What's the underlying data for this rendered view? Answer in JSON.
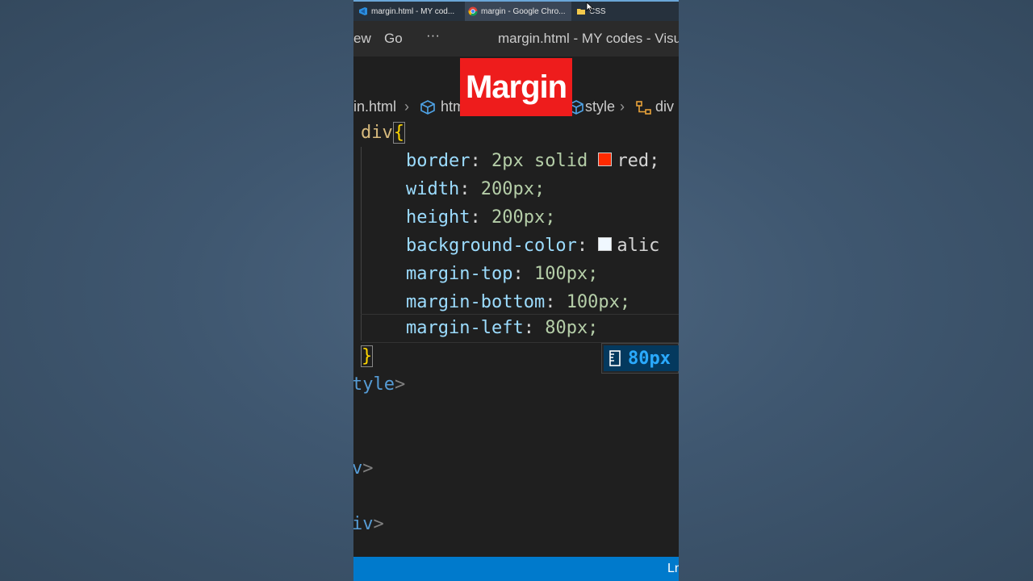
{
  "taskbar": {
    "tabs": [
      {
        "label": "margin.html - MY cod...",
        "icon": "vscode-icon",
        "active": false
      },
      {
        "label": "margin - Google Chro...",
        "icon": "chrome-icon",
        "active": true
      },
      {
        "label": "CSS",
        "icon": "folder-icon",
        "active": false
      }
    ]
  },
  "titlebar": {
    "menu_view": "ew",
    "menu_go": "Go",
    "more": "···",
    "window_title": "margin.html - MY codes - Visu"
  },
  "breadcrumb": {
    "file": "in.html",
    "html": "htm",
    "style": "style",
    "div": "div"
  },
  "overlay": {
    "title": "Margin"
  },
  "code": {
    "selector": "div",
    "open_brace": "{",
    "close_brace": "}",
    "declarations": [
      {
        "prop": "border",
        "value": "2px solid ",
        "swatch_color": "#ff2a00",
        "tail": "red;"
      },
      {
        "prop": "width",
        "value": "200px;"
      },
      {
        "prop": "height",
        "value": "200px;"
      },
      {
        "prop": "background-color",
        "value": "",
        "swatch_color": "#f0f8ff",
        "tail": "alic"
      },
      {
        "prop": "margin-top",
        "value": "100px;"
      },
      {
        "prop": "margin-bottom",
        "value": "100px;"
      },
      {
        "prop": "margin-left",
        "value": "80px;"
      }
    ],
    "style_close": "tyle",
    "div_close_1": "v",
    "div_close_2": "iv"
  },
  "suggestion": {
    "label": "80px"
  },
  "statusbar": {
    "text": "Ln"
  }
}
